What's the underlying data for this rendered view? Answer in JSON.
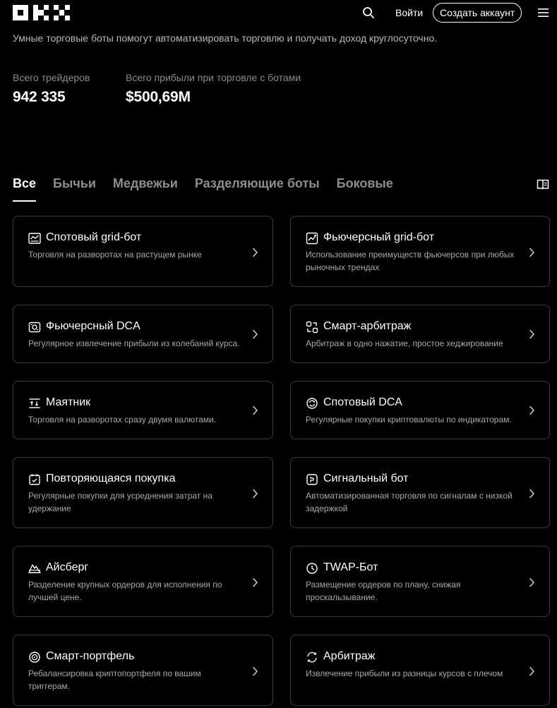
{
  "header": {
    "logo_text": "OKX",
    "login_label": "Войти",
    "signup_label": "Создать аккаунт"
  },
  "intro": {
    "subtitle": "Умные торговые боты помогут автоматизировать торговлю и получать доход круглосуточно."
  },
  "stats": [
    {
      "label": "Всего трейдеров",
      "value": "942 335"
    },
    {
      "label": "Всего прибыли при торговле с ботами",
      "value": "$500,69M"
    }
  ],
  "tabs": [
    {
      "label": "Все",
      "active": true
    },
    {
      "label": "Бычьи",
      "active": false
    },
    {
      "label": "Медвежьи",
      "active": false
    },
    {
      "label": "Разделяющие боты",
      "active": false
    },
    {
      "label": "Боковые",
      "active": false
    }
  ],
  "cards": [
    {
      "title": "Спотовый grid-бот",
      "desc": "Торговля на разворотах на растущем рынке",
      "icon": "grid-chart-icon"
    },
    {
      "title": "Фьючерсный grid-бот",
      "desc": "Использование преимуществ фьючерсов при любых рыночных трендах",
      "icon": "futures-grid-icon"
    },
    {
      "title": "Фьючерсный DCA",
      "desc": "Регулярное извлечение прибыли из колебаний курса.",
      "icon": "futures-dca-icon"
    },
    {
      "title": "Смарт-арбитраж",
      "desc": "Арбитраж в одно нажатие, простое хеджирование",
      "icon": "smart-arbitrage-icon"
    },
    {
      "title": "Маятник",
      "desc": "Торговля на разворотах сразу двумя валютами.",
      "icon": "pendulum-icon"
    },
    {
      "title": "Спотовый DCA",
      "desc": "Регулярные покупки криптовалюты по индикаторам.",
      "icon": "spot-dca-icon"
    },
    {
      "title": "Повторяющаяся покупка",
      "desc": "Регулярные покупки для усреднения затрат на удержание",
      "icon": "recurring-buy-icon"
    },
    {
      "title": "Сигнальный бот",
      "desc": "Автоматизированная торговля по сигналам с низкой задержкой",
      "icon": "signal-bot-icon"
    },
    {
      "title": "Айсберг",
      "desc": "Разделение крупных ордеров для исполнения по лучшей цене.",
      "icon": "iceberg-icon"
    },
    {
      "title": "TWAP-Бот",
      "desc": "Размещение ордеров по плану, снижая проскальзывание.",
      "icon": "twap-clock-icon"
    },
    {
      "title": "Смарт-портфель",
      "desc": "Ребалансировка криптопортфеля по вашим триггерам.",
      "icon": "smart-portfolio-icon"
    },
    {
      "title": "Арбитраж",
      "desc": "Извлечение прибыли из разницы курсов с плечом",
      "icon": "arbitrage-icon"
    }
  ]
}
